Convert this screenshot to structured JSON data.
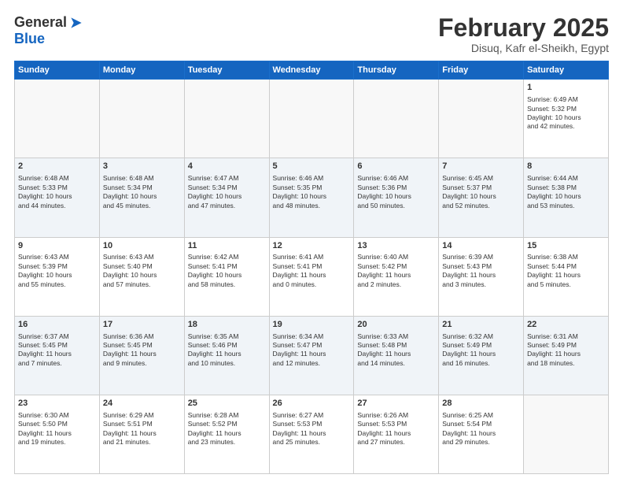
{
  "logo": {
    "general": "General",
    "blue": "Blue"
  },
  "header": {
    "title": "February 2025",
    "subtitle": "Disuq, Kafr el-Sheikh, Egypt"
  },
  "weekdays": [
    "Sunday",
    "Monday",
    "Tuesday",
    "Wednesday",
    "Thursday",
    "Friday",
    "Saturday"
  ],
  "weeks": [
    [
      {
        "day": "",
        "content": ""
      },
      {
        "day": "",
        "content": ""
      },
      {
        "day": "",
        "content": ""
      },
      {
        "day": "",
        "content": ""
      },
      {
        "day": "",
        "content": ""
      },
      {
        "day": "",
        "content": ""
      },
      {
        "day": "1",
        "content": "Sunrise: 6:49 AM\nSunset: 5:32 PM\nDaylight: 10 hours\nand 42 minutes."
      }
    ],
    [
      {
        "day": "2",
        "content": "Sunrise: 6:48 AM\nSunset: 5:33 PM\nDaylight: 10 hours\nand 44 minutes."
      },
      {
        "day": "3",
        "content": "Sunrise: 6:48 AM\nSunset: 5:34 PM\nDaylight: 10 hours\nand 45 minutes."
      },
      {
        "day": "4",
        "content": "Sunrise: 6:47 AM\nSunset: 5:34 PM\nDaylight: 10 hours\nand 47 minutes."
      },
      {
        "day": "5",
        "content": "Sunrise: 6:46 AM\nSunset: 5:35 PM\nDaylight: 10 hours\nand 48 minutes."
      },
      {
        "day": "6",
        "content": "Sunrise: 6:46 AM\nSunset: 5:36 PM\nDaylight: 10 hours\nand 50 minutes."
      },
      {
        "day": "7",
        "content": "Sunrise: 6:45 AM\nSunset: 5:37 PM\nDaylight: 10 hours\nand 52 minutes."
      },
      {
        "day": "8",
        "content": "Sunrise: 6:44 AM\nSunset: 5:38 PM\nDaylight: 10 hours\nand 53 minutes."
      }
    ],
    [
      {
        "day": "9",
        "content": "Sunrise: 6:43 AM\nSunset: 5:39 PM\nDaylight: 10 hours\nand 55 minutes."
      },
      {
        "day": "10",
        "content": "Sunrise: 6:43 AM\nSunset: 5:40 PM\nDaylight: 10 hours\nand 57 minutes."
      },
      {
        "day": "11",
        "content": "Sunrise: 6:42 AM\nSunset: 5:41 PM\nDaylight: 10 hours\nand 58 minutes."
      },
      {
        "day": "12",
        "content": "Sunrise: 6:41 AM\nSunset: 5:41 PM\nDaylight: 11 hours\nand 0 minutes."
      },
      {
        "day": "13",
        "content": "Sunrise: 6:40 AM\nSunset: 5:42 PM\nDaylight: 11 hours\nand 2 minutes."
      },
      {
        "day": "14",
        "content": "Sunrise: 6:39 AM\nSunset: 5:43 PM\nDaylight: 11 hours\nand 3 minutes."
      },
      {
        "day": "15",
        "content": "Sunrise: 6:38 AM\nSunset: 5:44 PM\nDaylight: 11 hours\nand 5 minutes."
      }
    ],
    [
      {
        "day": "16",
        "content": "Sunrise: 6:37 AM\nSunset: 5:45 PM\nDaylight: 11 hours\nand 7 minutes."
      },
      {
        "day": "17",
        "content": "Sunrise: 6:36 AM\nSunset: 5:45 PM\nDaylight: 11 hours\nand 9 minutes."
      },
      {
        "day": "18",
        "content": "Sunrise: 6:35 AM\nSunset: 5:46 PM\nDaylight: 11 hours\nand 10 minutes."
      },
      {
        "day": "19",
        "content": "Sunrise: 6:34 AM\nSunset: 5:47 PM\nDaylight: 11 hours\nand 12 minutes."
      },
      {
        "day": "20",
        "content": "Sunrise: 6:33 AM\nSunset: 5:48 PM\nDaylight: 11 hours\nand 14 minutes."
      },
      {
        "day": "21",
        "content": "Sunrise: 6:32 AM\nSunset: 5:49 PM\nDaylight: 11 hours\nand 16 minutes."
      },
      {
        "day": "22",
        "content": "Sunrise: 6:31 AM\nSunset: 5:49 PM\nDaylight: 11 hours\nand 18 minutes."
      }
    ],
    [
      {
        "day": "23",
        "content": "Sunrise: 6:30 AM\nSunset: 5:50 PM\nDaylight: 11 hours\nand 19 minutes."
      },
      {
        "day": "24",
        "content": "Sunrise: 6:29 AM\nSunset: 5:51 PM\nDaylight: 11 hours\nand 21 minutes."
      },
      {
        "day": "25",
        "content": "Sunrise: 6:28 AM\nSunset: 5:52 PM\nDaylight: 11 hours\nand 23 minutes."
      },
      {
        "day": "26",
        "content": "Sunrise: 6:27 AM\nSunset: 5:53 PM\nDaylight: 11 hours\nand 25 minutes."
      },
      {
        "day": "27",
        "content": "Sunrise: 6:26 AM\nSunset: 5:53 PM\nDaylight: 11 hours\nand 27 minutes."
      },
      {
        "day": "28",
        "content": "Sunrise: 6:25 AM\nSunset: 5:54 PM\nDaylight: 11 hours\nand 29 minutes."
      },
      {
        "day": "",
        "content": ""
      }
    ]
  ]
}
